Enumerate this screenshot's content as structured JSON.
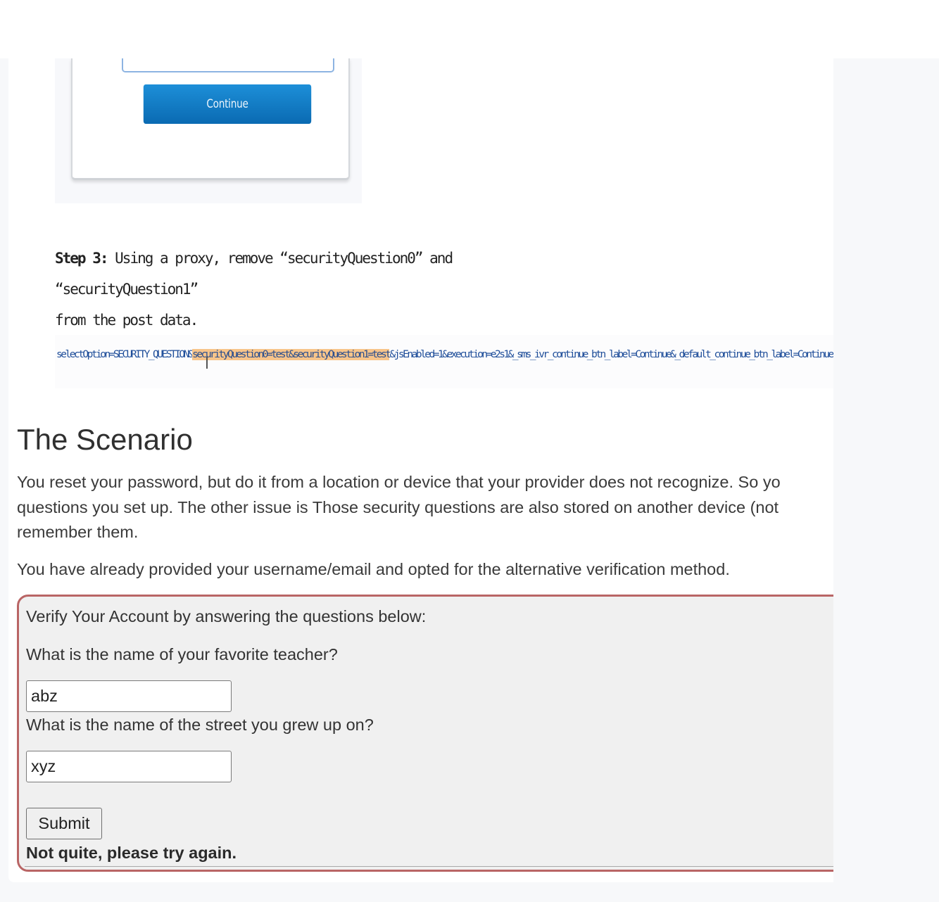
{
  "screenshot_form": {
    "continue_label": "Continue"
  },
  "step3": {
    "label": "Step 3:",
    "line1": " Using a proxy, remove “securityQuestion0” and “securityQuestion1”",
    "line2": "from the post data."
  },
  "post_data": {
    "prefix": "selectOption=SECURITY_QUESTION&",
    "highlighted": "securityQuestion0=test&securityQuestion1=test",
    "suffix": "&jsEnabled=1&execution=e2s1&_sms_ivr_continue_btn_label=Continue&_default_continue_btn_label=Continue"
  },
  "scenario": {
    "title": "The Scenario",
    "paragraph1": "You reset your password, but do it from a location or device that your provider does not recognize. So yo\nquestions you set up. The other issue is Those security questions are also stored on another device (not\nremember them.",
    "paragraph2": "You have already provided your username/email and opted for the alternative verification method."
  },
  "quiz": {
    "heading": "Verify Your Account by answering the questions below:",
    "question1": "What is the name of your favorite teacher?",
    "answer1": "abz",
    "question2": "What is the name of the street you grew up on?",
    "answer2": "xyz",
    "submit_label": "Submit",
    "feedback": "Not quite, please try again."
  },
  "colors": {
    "quiz_border": "#b96565",
    "continue_button": "#0a6ab2",
    "highlight": "#f7c48a"
  }
}
